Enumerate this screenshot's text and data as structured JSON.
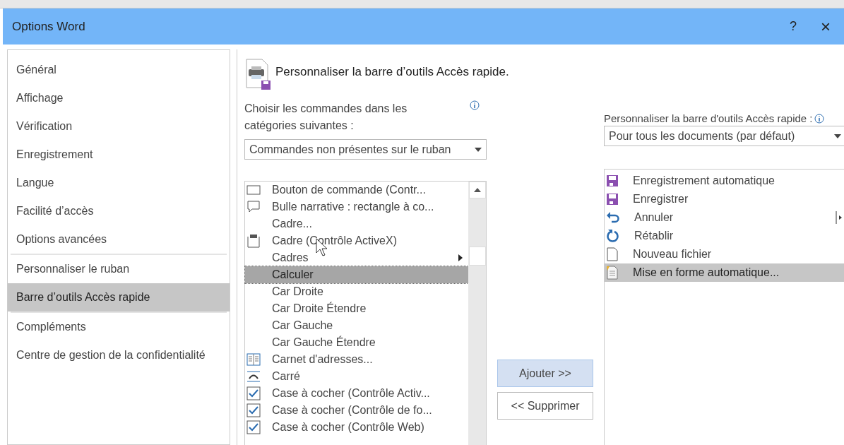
{
  "window": {
    "title": "Options Word",
    "help": "?",
    "close": "×"
  },
  "sidebar": {
    "items": [
      {
        "label": "Général",
        "selected": false,
        "divider_after": false
      },
      {
        "label": "Affichage",
        "selected": false,
        "divider_after": false
      },
      {
        "label": "Vérification",
        "selected": false,
        "divider_after": false
      },
      {
        "label": "Enregistrement",
        "selected": false,
        "divider_after": false
      },
      {
        "label": "Langue",
        "selected": false,
        "divider_after": false
      },
      {
        "label": "Facilité d’accès",
        "selected": false,
        "divider_after": false
      },
      {
        "label": "Options avancées",
        "selected": false,
        "divider_after": true
      },
      {
        "label": "Personnaliser le ruban",
        "selected": false,
        "divider_after": false
      },
      {
        "label": "Barre d’outils Accès rapide",
        "selected": true,
        "divider_after": true
      },
      {
        "label": "Compléments",
        "selected": false,
        "divider_after": false
      },
      {
        "label": "Centre de gestion de la confidentialité",
        "selected": false,
        "divider_after": false
      }
    ]
  },
  "heading": "Personnaliser la barre d’outils Accès rapide.",
  "commands_label": "Choisir les commandes dans les catégories suivantes :",
  "commands_dropdown": "Commandes non présentes sur le ruban",
  "commands": [
    {
      "label": "Bouton de commande (Contr...",
      "kind": "button-shape",
      "selected": false,
      "submenu": false
    },
    {
      "label": "Bulle narrative : rectangle à co...",
      "kind": "bubble",
      "selected": false,
      "submenu": false
    },
    {
      "label": "Cadre...",
      "kind": "none",
      "selected": false,
      "submenu": false
    },
    {
      "label": "Cadre (Contrôle ActiveX)",
      "kind": "frame",
      "selected": false,
      "submenu": false
    },
    {
      "label": "Cadres",
      "kind": "none",
      "selected": false,
      "submenu": true
    },
    {
      "label": "Calculer",
      "kind": "none",
      "selected": true,
      "submenu": false
    },
    {
      "label": "Car Droite",
      "kind": "none",
      "selected": false,
      "submenu": false
    },
    {
      "label": "Car Droite Étendre",
      "kind": "none",
      "selected": false,
      "submenu": false
    },
    {
      "label": "Car Gauche",
      "kind": "none",
      "selected": false,
      "submenu": false
    },
    {
      "label": "Car Gauche Étendre",
      "kind": "none",
      "selected": false,
      "submenu": false
    },
    {
      "label": "Carnet d'adresses...",
      "kind": "book",
      "selected": false,
      "submenu": false
    },
    {
      "label": "Carré",
      "kind": "wrap",
      "selected": false,
      "submenu": false
    },
    {
      "label": "Case à cocher (Contrôle Activ...",
      "kind": "checkbox",
      "selected": false,
      "submenu": false
    },
    {
      "label": "Case à cocher (Contrôle de fo...",
      "kind": "checkbox",
      "selected": false,
      "submenu": false
    },
    {
      "label": "Case à cocher (Contrôle Web)",
      "kind": "checkbox",
      "selected": false,
      "submenu": false
    }
  ],
  "add_button": "Ajouter >>",
  "remove_button": "<< Supprimer",
  "toolbar_label": "Personnaliser la barre d'outils Accès rapide :",
  "toolbar_dropdown": "Pour tous les documents (par défaut)",
  "toolbar_items": [
    {
      "label": "Enregistrement automatique",
      "kind": "save",
      "selected": false
    },
    {
      "label": "Enregistrer",
      "kind": "save",
      "selected": false
    },
    {
      "label": "Annuler",
      "kind": "undo",
      "selected": false
    },
    {
      "label": "Rétablir",
      "kind": "redo",
      "selected": false
    },
    {
      "label": "Nouveau fichier",
      "kind": "page",
      "selected": false
    },
    {
      "label": "Mise en forme automatique...",
      "kind": "autoformat",
      "selected": true
    }
  ]
}
